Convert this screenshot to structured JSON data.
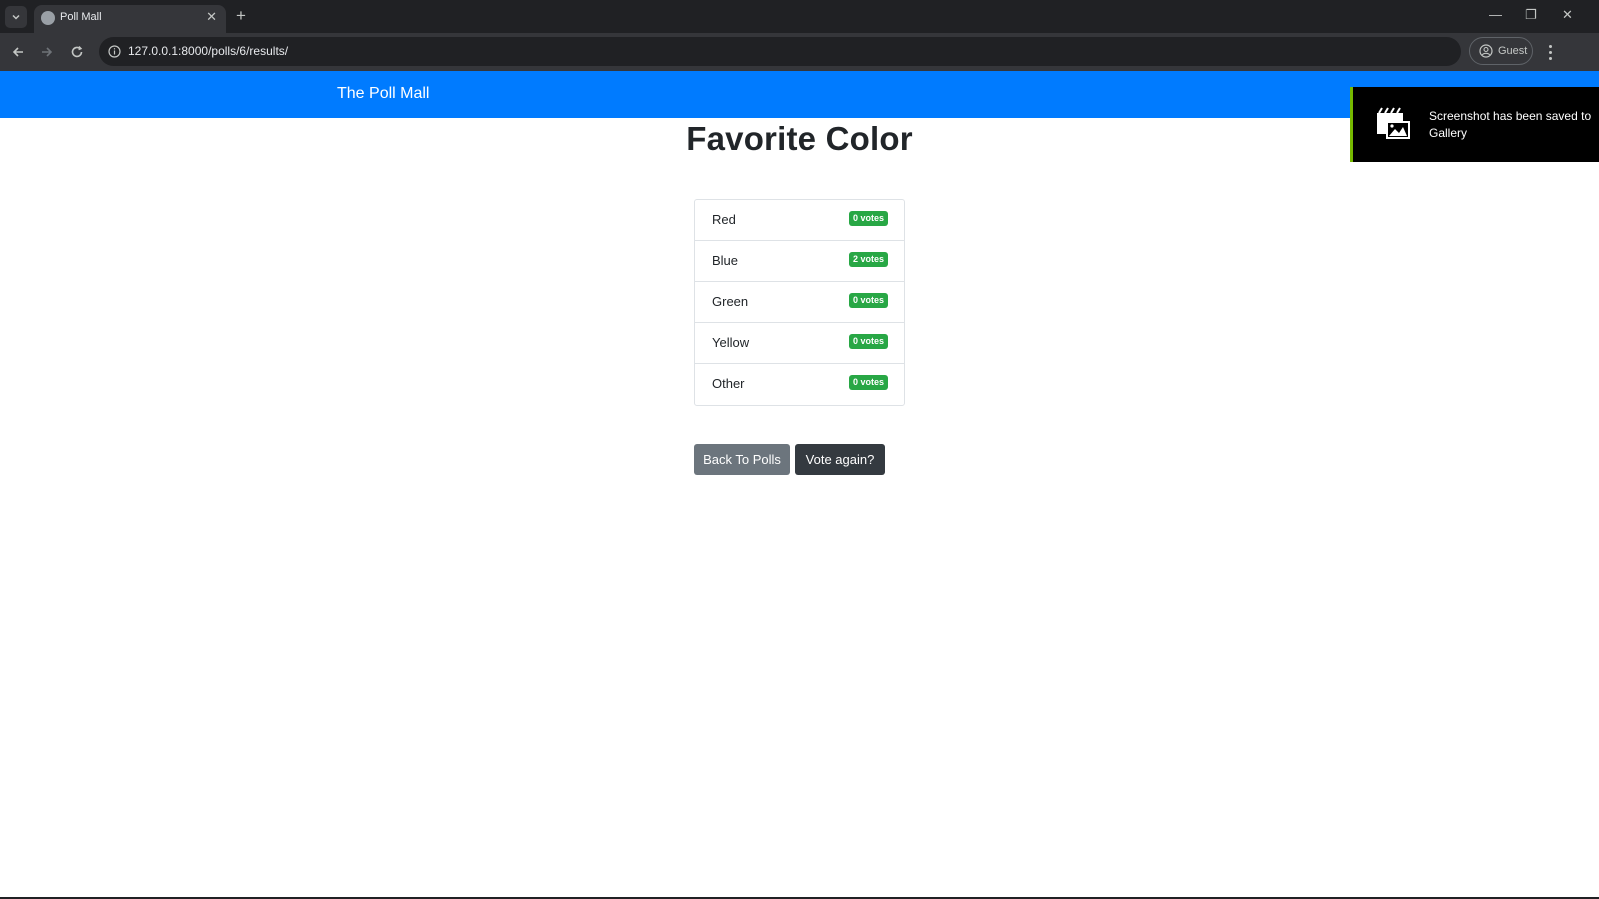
{
  "browser": {
    "tab_title": "Poll Mall",
    "tab_close": "✕",
    "new_tab": "+",
    "url": "127.0.0.1:8000/polls/6/results/",
    "profile_label": "Guest",
    "window_controls": {
      "minimize": "—",
      "restore": "❐",
      "close": "✕"
    }
  },
  "navbar": {
    "brand": "The Poll Mall",
    "accent_color": "#007bff"
  },
  "poll": {
    "question": "Favorite Color",
    "choices": [
      {
        "label": "Red",
        "votes": "0 votes"
      },
      {
        "label": "Blue",
        "votes": "2 votes"
      },
      {
        "label": "Green",
        "votes": "0 votes"
      },
      {
        "label": "Yellow",
        "votes": "0 votes"
      },
      {
        "label": "Other",
        "votes": "0 votes"
      }
    ],
    "badge_color": "#28a745"
  },
  "actions": {
    "back_label": "Back To Polls",
    "vote_again_label": "Vote again?"
  },
  "toast": {
    "message": "Screenshot has been saved to Gallery",
    "icon": "clapperboard-gallery-icon"
  }
}
